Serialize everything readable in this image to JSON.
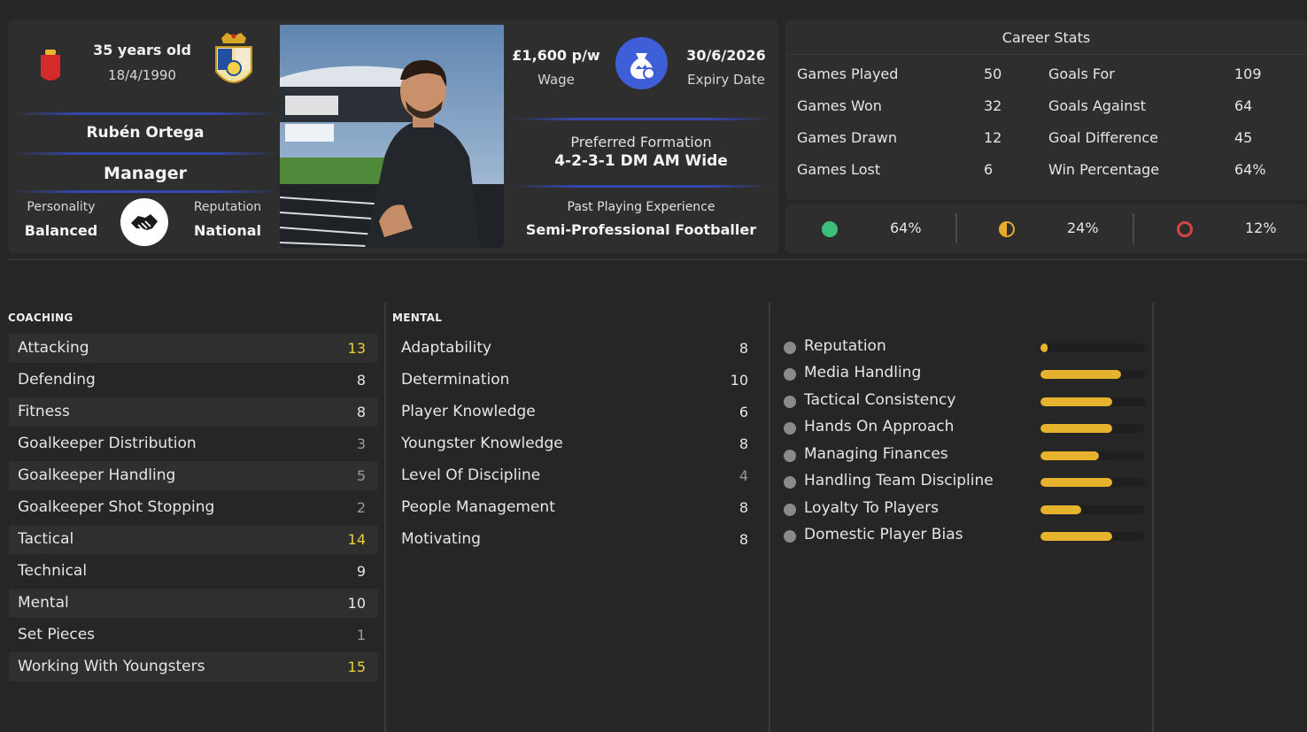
{
  "profile": {
    "age": "35 years old",
    "dob": "18/4/1990",
    "name": "Rubén Ortega",
    "role": "Manager",
    "personality_label": "Personality",
    "personality_value": "Balanced",
    "reputation_label": "Reputation",
    "reputation_value": "National",
    "nation_flag_icon": "spain-flag-icon",
    "club_crest_icon": "club-crest-icon",
    "personality_icon": "handshake-icon"
  },
  "contract": {
    "wage_value": "£1,600 p/w",
    "wage_label": "Wage",
    "money_icon": "money-bag-icon",
    "expiry_value": "30/6/2026",
    "expiry_label": "Expiry Date",
    "formation_label": "Preferred Formation",
    "formation_value": "4-2-3-1 DM AM Wide",
    "experience_label": "Past Playing Experience",
    "experience_value": "Semi-Professional Footballer"
  },
  "career": {
    "title": "Career Stats",
    "left": [
      {
        "label": "Games Played",
        "value": "50"
      },
      {
        "label": "Games Won",
        "value": "32"
      },
      {
        "label": "Games Drawn",
        "value": "12"
      },
      {
        "label": "Games Lost",
        "value": "6"
      }
    ],
    "right": [
      {
        "label": "Goals For",
        "value": "109"
      },
      {
        "label": "Goals Against",
        "value": "64"
      },
      {
        "label": "Goal Difference",
        "value": "45"
      },
      {
        "label": "Win Percentage",
        "value": "64%"
      }
    ],
    "results": [
      {
        "icon": "win-dot-icon",
        "color": "#3dbf7a",
        "value": "64%"
      },
      {
        "icon": "draw-dot-icon",
        "color": "#e8a92c",
        "value": "24%"
      },
      {
        "icon": "loss-ring-icon",
        "color": "#d64545",
        "value": "12%"
      }
    ]
  },
  "coaching": {
    "title": "COACHING",
    "items": [
      {
        "label": "Attacking",
        "value": "13"
      },
      {
        "label": "Defending",
        "value": "8"
      },
      {
        "label": "Fitness",
        "value": "8"
      },
      {
        "label": "Goalkeeper Distribution",
        "value": "3"
      },
      {
        "label": "Goalkeeper Handling",
        "value": "5"
      },
      {
        "label": "Goalkeeper Shot Stopping",
        "value": "2"
      },
      {
        "label": "Tactical",
        "value": "14"
      },
      {
        "label": "Technical",
        "value": "9"
      },
      {
        "label": "Mental",
        "value": "10"
      },
      {
        "label": "Set Pieces",
        "value": "1"
      },
      {
        "label": "Working With Youngsters",
        "value": "15"
      }
    ]
  },
  "mental": {
    "title": "MENTAL",
    "items": [
      {
        "label": "Adaptability",
        "value": "8"
      },
      {
        "label": "Determination",
        "value": "10"
      },
      {
        "label": "Player Knowledge",
        "value": "6"
      },
      {
        "label": "Youngster Knowledge",
        "value": "8"
      },
      {
        "label": "Level Of Discipline",
        "value": "4"
      },
      {
        "label": "People Management",
        "value": "8"
      },
      {
        "label": "Motivating",
        "value": "8"
      }
    ]
  },
  "traits": {
    "items": [
      {
        "label": "Reputation",
        "level": 0.07
      },
      {
        "label": "Media Handling",
        "level": 0.77
      },
      {
        "label": "Tactical Consistency",
        "level": 0.69
      },
      {
        "label": "Hands On Approach",
        "level": 0.69
      },
      {
        "label": "Managing Finances",
        "level": 0.56
      },
      {
        "label": "Handling Team Discipline",
        "level": 0.69
      },
      {
        "label": "Loyalty To Players",
        "level": 0.39
      },
      {
        "label": "Domestic Player Bias",
        "level": 0.69
      }
    ]
  },
  "colors": {
    "accent_blue": "#3e5fd8",
    "highlight_yellow": "#e8cf3a",
    "bar_gold": "#e8b32c"
  }
}
